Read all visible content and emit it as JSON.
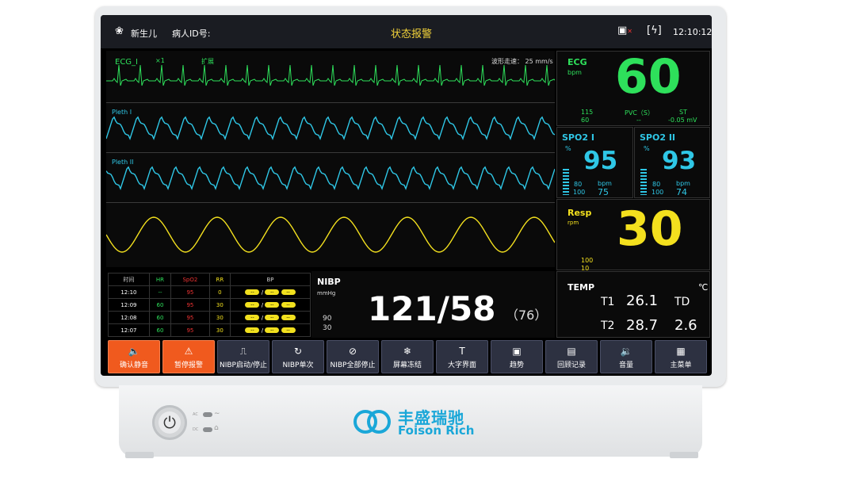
{
  "topbar": {
    "patient_type": "新生儿",
    "patient_id_label": "病人ID号:",
    "status_title": "状态报警",
    "time": "12:10:12"
  },
  "waves": {
    "ecg_label": "ECG_I",
    "ecg_gain": "×1",
    "ecg_filter": "扩展",
    "sweep_speed": "波形走速： 25 mm/s",
    "pleth1_label": "Pleth I",
    "pleth2_label": "Pleth II"
  },
  "ecg": {
    "name": "ECG",
    "unit": "bpm",
    "value": "60",
    "hr_high": "115",
    "hr_low": "60",
    "pvc_label": "PVC（S）",
    "pvc_value": "--",
    "st_label": "ST",
    "st_value": "-0.05 mV"
  },
  "spo2_1": {
    "name": "SPO2 I",
    "unit": "%",
    "value": "95",
    "low": "80",
    "high": "100",
    "pr_unit": "bpm",
    "pr_value": "75"
  },
  "spo2_2": {
    "name": "SPO2 II",
    "unit": "%",
    "value": "93",
    "low": "80",
    "high": "100",
    "pr_unit": "bpm",
    "pr_value": "74"
  },
  "resp": {
    "name": "Resp",
    "unit": "rpm",
    "value": "30",
    "high": "100",
    "low": "10"
  },
  "trend_table": {
    "headers": [
      "时间",
      "HR",
      "SpO2",
      "RR",
      "BP"
    ],
    "rows": [
      {
        "time": "12:10",
        "hr": "--",
        "spo2": "95",
        "rr": "0"
      },
      {
        "time": "12:09",
        "hr": "60",
        "spo2": "95",
        "rr": "30"
      },
      {
        "time": "12:08",
        "hr": "60",
        "spo2": "95",
        "rr": "30"
      },
      {
        "time": "12:07",
        "hr": "60",
        "spo2": "95",
        "rr": "30"
      }
    ]
  },
  "nibp": {
    "name": "NIBP",
    "unit": "mmHg",
    "value": "121/58",
    "mean": "（76）",
    "high": "90",
    "low": "30"
  },
  "temp": {
    "name": "TEMP",
    "unit": "℃",
    "t1_label": "T1",
    "t1_value": "26.1",
    "t2_label": "T2",
    "t2_value": "28.7",
    "td_label": "TD",
    "td_value": "2.6"
  },
  "buttons": [
    {
      "label": "确认静音",
      "icon": "speaker-icon"
    },
    {
      "label": "暂停报警",
      "icon": "alarm-icon"
    },
    {
      "label": "NIBP启动/停止",
      "icon": "cuff-icon"
    },
    {
      "label": "NIBP单次",
      "icon": "cycle-icon"
    },
    {
      "label": "NIBP全部停止",
      "icon": "stop-all-icon"
    },
    {
      "label": "屏幕冻结",
      "icon": "snowflake-icon"
    },
    {
      "label": "大字界面",
      "icon": "big-font-icon"
    },
    {
      "label": "趋势",
      "icon": "trend-icon"
    },
    {
      "label": "回顾记录",
      "icon": "review-icon"
    },
    {
      "label": "音量",
      "icon": "volume-icon"
    },
    {
      "label": "主菜单",
      "icon": "menu-icon"
    }
  ],
  "device": {
    "brand_cn": "丰盛瑞驰",
    "brand_en": "Foison Rich",
    "led_ac": "AC",
    "led_dc": "DC"
  },
  "colors": {
    "ecg_green": "#2ee05b",
    "spo2_cyan": "#2fc7e6",
    "resp_yellow": "#f3e01e",
    "alarm_yellow": "#f2d23a",
    "button_orange": "#f05a1e"
  }
}
